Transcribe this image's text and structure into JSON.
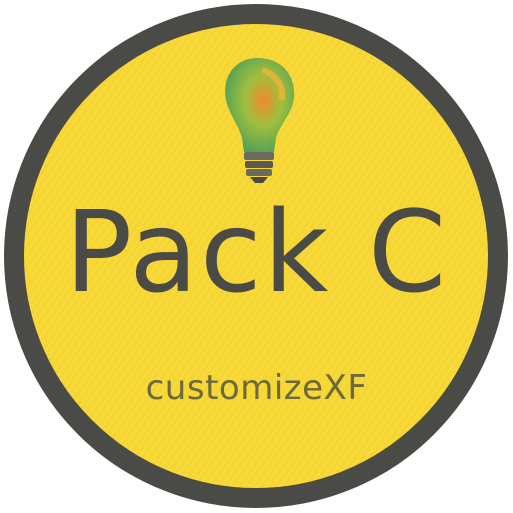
{
  "badge": {
    "title": "Pack C",
    "brand": "customizeXF",
    "icon": "lightbulb-icon"
  },
  "colors": {
    "background": "#ffffff",
    "circle_fill": "#f7d93a",
    "circle_border": "#4a4a46",
    "title_text": "#4a4a46",
    "brand_text": "#6b6a3c",
    "bulb_green": "#6fb54a",
    "bulb_orange": "#f08a2c",
    "bulb_yellow": "#e8c53a",
    "bulb_base": "#5a5a52"
  }
}
